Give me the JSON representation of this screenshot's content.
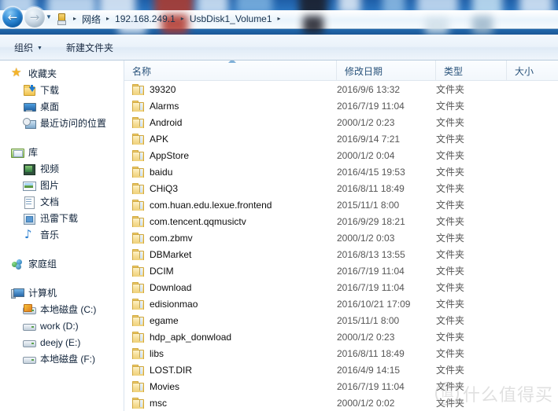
{
  "titlebar": {
    "back_label": "←",
    "forward_label": "→",
    "history_caret": "▼",
    "breadcrumb_icon": "usb-drive-icon",
    "breadcrumb": [
      {
        "label": "网络"
      },
      {
        "label": "192.168.249.1"
      },
      {
        "label": "UsbDisk1_Volume1"
      }
    ],
    "separator": "▸"
  },
  "commandbar": {
    "organize_label": "组织",
    "organize_caret": "▼",
    "new_folder_label": "新建文件夹"
  },
  "sidebar": {
    "groups": [
      {
        "name": "favorites",
        "header": {
          "label": "收藏夹",
          "icon": "star-icon"
        },
        "items": [
          {
            "label": "下载",
            "icon": "downloads-icon"
          },
          {
            "label": "桌面",
            "icon": "desktop-icon"
          },
          {
            "label": "最近访问的位置",
            "icon": "recent-places-icon"
          }
        ]
      },
      {
        "name": "libraries",
        "header": {
          "label": "库",
          "icon": "library-icon"
        },
        "items": [
          {
            "label": "视频",
            "icon": "videos-icon"
          },
          {
            "label": "图片",
            "icon": "pictures-icon"
          },
          {
            "label": "文档",
            "icon": "documents-icon"
          },
          {
            "label": "迅雷下载",
            "icon": "xunlei-download-icon"
          },
          {
            "label": "音乐",
            "icon": "music-icon"
          }
        ]
      },
      {
        "name": "homegroup",
        "header": {
          "label": "家庭组",
          "icon": "homegroup-icon"
        },
        "items": []
      },
      {
        "name": "computer",
        "header": {
          "label": "计算机",
          "icon": "computer-icon"
        },
        "items": [
          {
            "label": "本地磁盘 (C:)",
            "icon": "system-drive-icon"
          },
          {
            "label": "work (D:)",
            "icon": "drive-icon"
          },
          {
            "label": "deejy (E:)",
            "icon": "drive-icon"
          },
          {
            "label": "本地磁盘 (F:)",
            "icon": "drive-icon"
          }
        ]
      }
    ]
  },
  "filelist": {
    "columns": [
      {
        "key": "name",
        "label": "名称",
        "sorted": "asc"
      },
      {
        "key": "date",
        "label": "修改日期"
      },
      {
        "key": "type",
        "label": "类型"
      },
      {
        "key": "size",
        "label": "大小"
      }
    ],
    "rows": [
      {
        "name": "39320",
        "date": "2016/9/6 13:32",
        "type": "文件夹",
        "size": ""
      },
      {
        "name": "Alarms",
        "date": "2016/7/19 11:04",
        "type": "文件夹",
        "size": ""
      },
      {
        "name": "Android",
        "date": "2000/1/2 0:23",
        "type": "文件夹",
        "size": ""
      },
      {
        "name": "APK",
        "date": "2016/9/14 7:21",
        "type": "文件夹",
        "size": ""
      },
      {
        "name": "AppStore",
        "date": "2000/1/2 0:04",
        "type": "文件夹",
        "size": ""
      },
      {
        "name": "baidu",
        "date": "2016/4/15 19:53",
        "type": "文件夹",
        "size": ""
      },
      {
        "name": "CHiQ3",
        "date": "2016/8/11 18:49",
        "type": "文件夹",
        "size": ""
      },
      {
        "name": "com.huan.edu.lexue.frontend",
        "date": "2015/11/1 8:00",
        "type": "文件夹",
        "size": ""
      },
      {
        "name": "com.tencent.qqmusictv",
        "date": "2016/9/29 18:21",
        "type": "文件夹",
        "size": ""
      },
      {
        "name": "com.zbmv",
        "date": "2000/1/2 0:03",
        "type": "文件夹",
        "size": ""
      },
      {
        "name": "DBMarket",
        "date": "2016/8/13 13:55",
        "type": "文件夹",
        "size": ""
      },
      {
        "name": "DCIM",
        "date": "2016/7/19 11:04",
        "type": "文件夹",
        "size": ""
      },
      {
        "name": "Download",
        "date": "2016/7/19 11:04",
        "type": "文件夹",
        "size": ""
      },
      {
        "name": "edisionmao",
        "date": "2016/10/21 17:09",
        "type": "文件夹",
        "size": ""
      },
      {
        "name": "egame",
        "date": "2015/11/1 8:00",
        "type": "文件夹",
        "size": ""
      },
      {
        "name": "hdp_apk_donwload",
        "date": "2000/1/2 0:23",
        "type": "文件夹",
        "size": ""
      },
      {
        "name": "libs",
        "date": "2016/8/11 18:49",
        "type": "文件夹",
        "size": ""
      },
      {
        "name": "LOST.DIR",
        "date": "2016/4/9 14:15",
        "type": "文件夹",
        "size": ""
      },
      {
        "name": "Movies",
        "date": "2016/7/19 11:04",
        "type": "文件夹",
        "size": ""
      },
      {
        "name": "msc",
        "date": "2000/1/2 0:02",
        "type": "文件夹",
        "size": ""
      }
    ]
  },
  "watermark": {
    "mark": "值",
    "text": "什么值得买"
  }
}
